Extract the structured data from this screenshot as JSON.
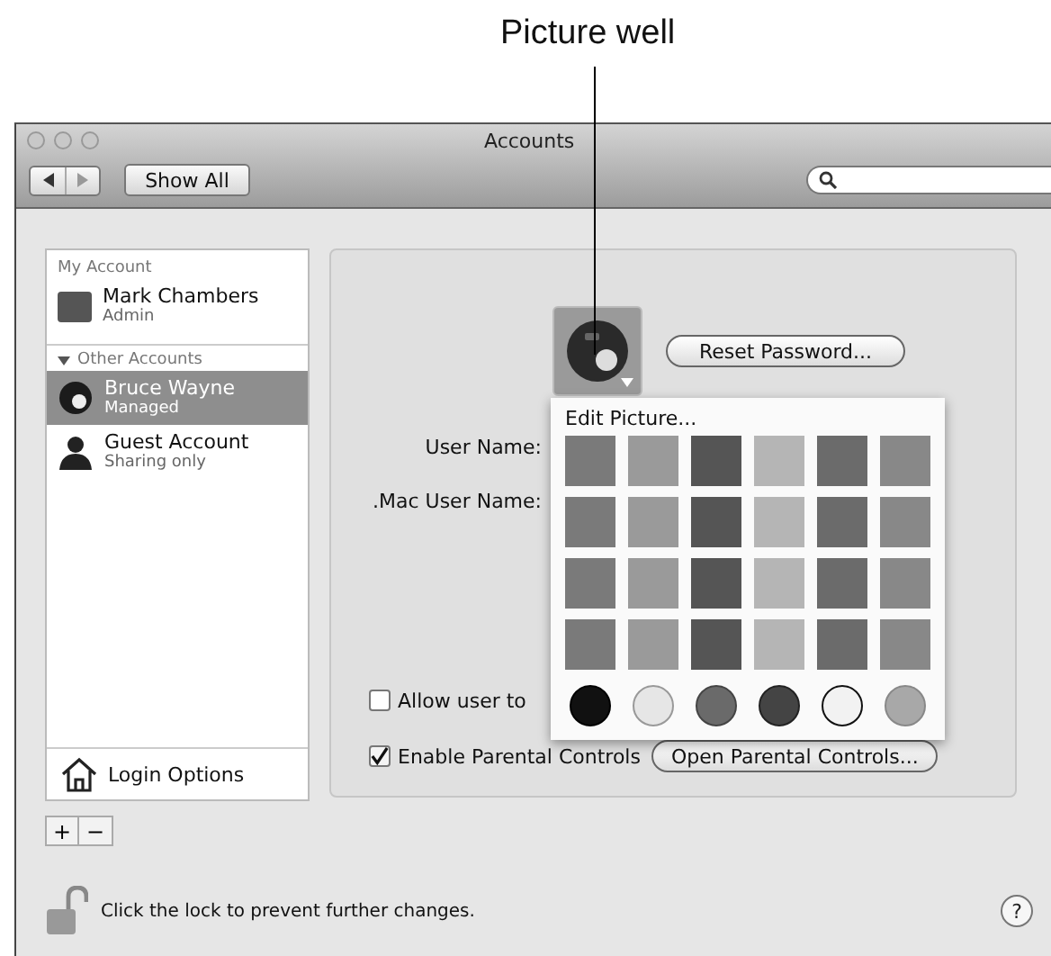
{
  "callout": {
    "label": "Picture well"
  },
  "window": {
    "title": "Accounts"
  },
  "toolbar": {
    "show_all": "Show All"
  },
  "sidebar": {
    "sections": [
      {
        "header": "My Account",
        "accounts": [
          {
            "name": "Mark Chambers",
            "role": "Admin",
            "kind": "photo",
            "selected": false
          }
        ]
      },
      {
        "header": "Other Accounts",
        "expanded": true,
        "accounts": [
          {
            "name": "Bruce Wayne",
            "role": "Managed",
            "kind": "ball",
            "selected": true
          },
          {
            "name": "Guest Account",
            "role": "Sharing only",
            "kind": "silhouette",
            "selected": false
          }
        ]
      }
    ],
    "login_options": "Login Options",
    "add": "+",
    "remove": "−"
  },
  "panel": {
    "reset_button": "Reset Password...",
    "fields": [
      {
        "label": "User Name:"
      },
      {
        "label": ".Mac User Name:"
      }
    ],
    "checkboxes": [
      {
        "label": "Allow user to",
        "checked": false
      },
      {
        "label": "Enable Parental Controls",
        "checked": true
      }
    ],
    "parental_button": "Open Parental Controls..."
  },
  "picture_menu": {
    "title": "Edit Picture..."
  },
  "footer": {
    "lock_text": "Click the lock to prevent further changes.",
    "help": "?"
  }
}
